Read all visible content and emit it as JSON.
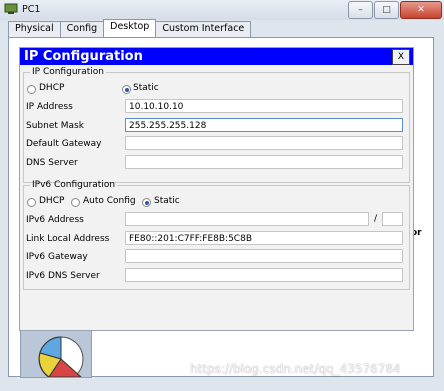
{
  "window": {
    "title": "PC1",
    "controls": [
      "–",
      "□",
      "✕"
    ]
  },
  "tabs": [
    "Physical",
    "Config",
    "Desktop",
    "Custom Interface"
  ],
  "active_tab": "Desktop",
  "dialog": {
    "title": "IP Configuration",
    "close_label": "X",
    "ipv4": {
      "section_label": "IP Configuration",
      "dhcp_label": "DHCP",
      "static_label": "Static",
      "selected": "Static",
      "fields": [
        {
          "label": "IP Address",
          "value": "10.10.10.10"
        },
        {
          "label": "Subnet Mask",
          "value": "255.255.255.128"
        },
        {
          "label": "Default Gateway",
          "value": ""
        },
        {
          "label": "DNS Server",
          "value": ""
        }
      ]
    },
    "ipv6": {
      "section_label": "IPv6 Configuration",
      "dhcp_label": "DHCP",
      "auto_label": "Auto Config",
      "static_label": "Static",
      "selected": "Static",
      "address_label": "IPv6 Address",
      "address_value": "",
      "prefix_separator": "/",
      "prefix_value": "",
      "link_local_label": "Link Local Address",
      "link_local_value": "FE80::201:C7FF:FE8B:5C8B",
      "gateway_label": "IPv6 Gateway",
      "gateway_value": "",
      "dns_label": "IPv6 DNS Server",
      "dns_value": ""
    }
  },
  "background": {
    "partial_text": "or"
  },
  "watermark": "https://blog.csdn.net/qq_43576784",
  "colors": {
    "dialog_header": "#0000ff",
    "window_bg": "#dfe5ec"
  }
}
